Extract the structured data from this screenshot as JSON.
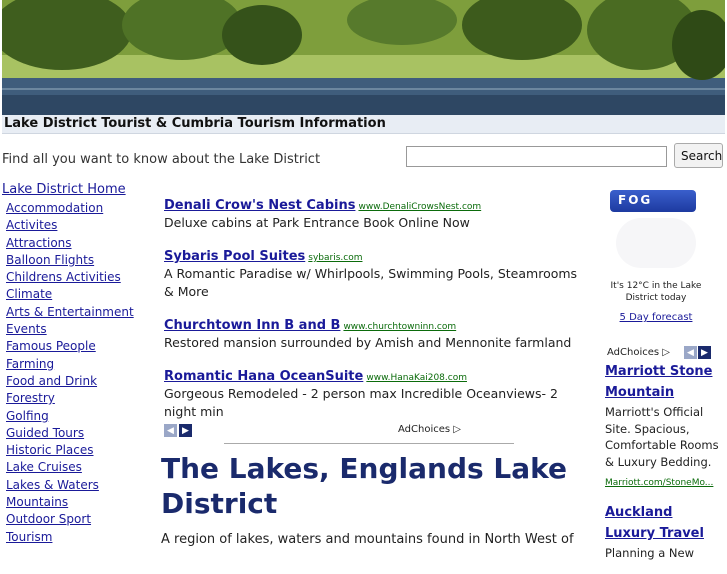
{
  "header": {
    "title": "Lake District Tourist & Cumbria Tourism Information",
    "tagline": "Find all you want to know about the Lake District"
  },
  "search": {
    "value": "",
    "placeholder": "",
    "button_label": "Search"
  },
  "sidebar": {
    "home": "Lake District Home",
    "items": [
      "Accommodation",
      "Activites",
      "Attractions",
      "Balloon Flights",
      "Childrens Activities",
      "Climate",
      "Arts & Entertainment",
      "Events",
      "Famous People",
      "Farming",
      "Food and Drink",
      "Forestry",
      "Golfing",
      "Guided Tours",
      "Historic Places",
      "Lake Cruises",
      "Lakes & Waters",
      "Mountains",
      "Outdoor Sport",
      "Tourism"
    ]
  },
  "ads": [
    {
      "title": "Denali Crow's Nest Cabins",
      "url": "www.DenaliCrowsNest.com",
      "desc": "Deluxe cabins at Park Entrance Book Online Now"
    },
    {
      "title": "Sybaris Pool Suites",
      "url": "sybaris.com",
      "desc": "A Romantic Paradise w/ Whirlpools, Swimming Pools, Steamrooms & More"
    },
    {
      "title": "Churchtown Inn B and B",
      "url": "www.churchtowninn.com",
      "desc": "Restored mansion surrounded by Amish and Mennonite farmland"
    },
    {
      "title": "Romantic Hana OceanSuite",
      "url": "www.HanaKai208.com",
      "desc": "Gorgeous Remodeled - 2 person max Incredible Oceanviews- 2 night min"
    }
  ],
  "adchoices_label": "AdChoices",
  "main": {
    "heading": "The Lakes, Englands Lake District",
    "intro": "A region of lakes, waters and mountains found in North West of"
  },
  "weather": {
    "badge": "FOG",
    "text": "It's 12°C in the Lake District today",
    "forecast_link": "5 Day forecast"
  },
  "right_ads": [
    {
      "title": "Marriott Stone Mountain",
      "desc": "Marriott's Official Site. Spacious, Comfortable Rooms & Luxury Bedding.",
      "url": "Marriott.com/StoneMo..."
    },
    {
      "title": "Auckland Luxury Travel",
      "desc": "Planning a New",
      "url": ""
    }
  ],
  "colors": {
    "link": "#1a1a99",
    "heading": "#1a2a6c",
    "ad_url": "#0b6b0b",
    "title_bar_bg": "#e8edf4"
  },
  "icons": {
    "prev": "chevron-left-icon",
    "next": "chevron-right-icon",
    "adchoices": "adchoices-triangle-icon"
  }
}
